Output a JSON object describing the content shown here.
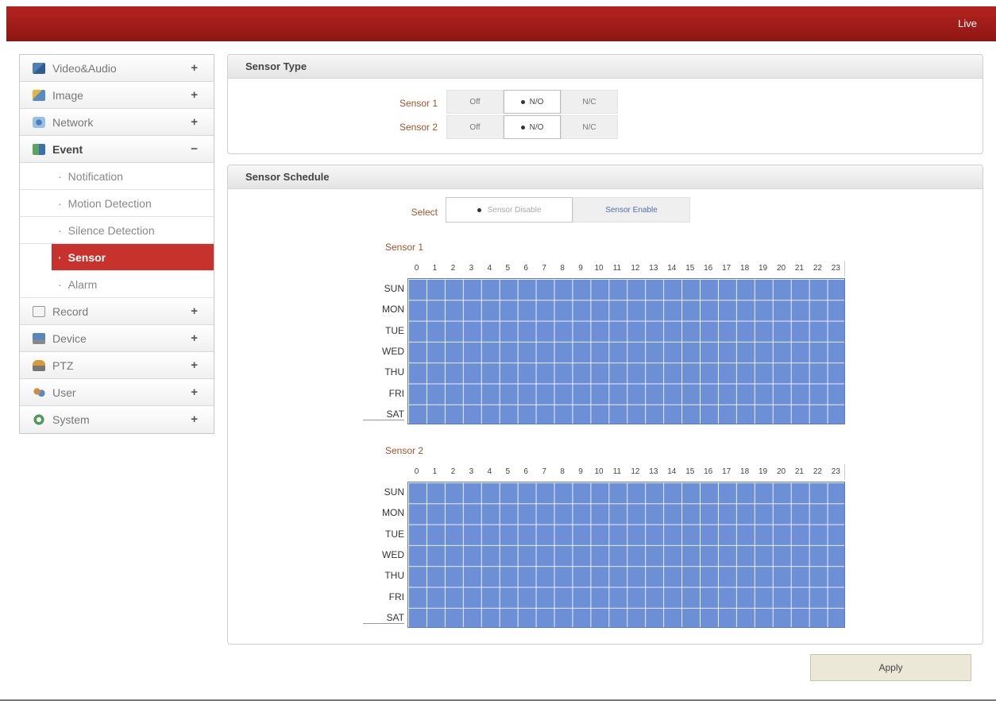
{
  "header": {
    "live_label": "Live"
  },
  "sidebar": {
    "items": [
      {
        "label": "Video&Audio",
        "toggle": "+",
        "icon": "video-audio-icon"
      },
      {
        "label": "Image",
        "toggle": "+",
        "icon": "image-icon"
      },
      {
        "label": "Network",
        "toggle": "+",
        "icon": "network-icon"
      },
      {
        "label": "Event",
        "toggle": "−",
        "icon": "event-icon"
      },
      {
        "label": "Record",
        "toggle": "+",
        "icon": "record-icon"
      },
      {
        "label": "Device",
        "toggle": "+",
        "icon": "device-icon"
      },
      {
        "label": "PTZ",
        "toggle": "+",
        "icon": "ptz-icon"
      },
      {
        "label": "User",
        "toggle": "+",
        "icon": "user-icon"
      },
      {
        "label": "System",
        "toggle": "+",
        "icon": "system-icon"
      }
    ],
    "event_subitems": [
      {
        "label": "Notification"
      },
      {
        "label": "Motion Detection"
      },
      {
        "label": "Silence Detection"
      },
      {
        "label": "Sensor",
        "active": true
      },
      {
        "label": "Alarm"
      }
    ],
    "bullet": "·"
  },
  "sensor_type": {
    "title": "Sensor Type",
    "rows": [
      {
        "label": "Sensor 1",
        "options": [
          "Off",
          "N/O",
          "N/C"
        ],
        "selected": "N/O"
      },
      {
        "label": "Sensor 2",
        "options": [
          "Off",
          "N/O",
          "N/C"
        ],
        "selected": "N/O"
      }
    ]
  },
  "sensor_schedule": {
    "title": "Sensor Schedule",
    "select_label": "Select",
    "select_options": [
      "Sensor Disable",
      "Sensor Enable"
    ],
    "selected_option": "Sensor Disable",
    "hours": [
      "0",
      "1",
      "2",
      "3",
      "4",
      "5",
      "6",
      "7",
      "8",
      "9",
      "10",
      "11",
      "12",
      "13",
      "14",
      "15",
      "16",
      "17",
      "18",
      "19",
      "20",
      "21",
      "22",
      "23"
    ],
    "days": [
      "SUN",
      "MON",
      "TUE",
      "WED",
      "THU",
      "FRI",
      "SAT"
    ],
    "sensors": [
      {
        "title": "Sensor 1",
        "all_enabled": true
      },
      {
        "title": "Sensor 2",
        "all_enabled": true
      }
    ],
    "cell_color": "#6d8fd6"
  },
  "footer": {
    "apply_label": "Apply"
  },
  "colors": {
    "brand_red": "#a01c18",
    "active_menu": "#c8322d"
  }
}
